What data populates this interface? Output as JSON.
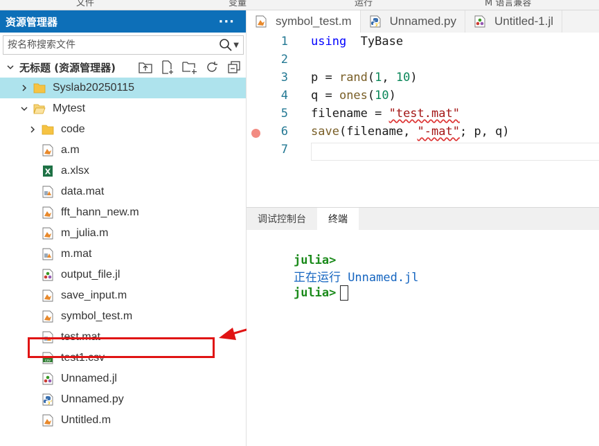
{
  "menu": [
    "文件",
    "变量",
    "运行",
    "M 语言兼容"
  ],
  "sidebar": {
    "title": "资源管理器",
    "more": "···",
    "search_placeholder": "按名称搜索文件",
    "root_label": "无标题 (资源管理器)",
    "items": [
      {
        "label": "Syslab20250115",
        "icon": "folder-icon",
        "depth": 1,
        "expanded": false,
        "selected": true
      },
      {
        "label": "Mytest",
        "icon": "folder-open-icon",
        "depth": 1,
        "expanded": true
      },
      {
        "label": "code",
        "icon": "folder-icon",
        "depth": 2,
        "expanded": false
      },
      {
        "label": "a.m",
        "icon": "m-file-icon",
        "depth": 2
      },
      {
        "label": "a.xlsx",
        "icon": "excel-icon",
        "depth": 2
      },
      {
        "label": "data.mat",
        "icon": "mat-file-icon",
        "depth": 2
      },
      {
        "label": "fft_hann_new.m",
        "icon": "m-file-icon",
        "depth": 2
      },
      {
        "label": "m_julia.m",
        "icon": "m-file-icon",
        "depth": 2
      },
      {
        "label": "m.mat",
        "icon": "mat-file-icon",
        "depth": 2
      },
      {
        "label": "output_file.jl",
        "icon": "julia-icon",
        "depth": 2
      },
      {
        "label": "save_input.m",
        "icon": "m-file-icon",
        "depth": 2
      },
      {
        "label": "symbol_test.m",
        "icon": "m-file-icon",
        "depth": 2
      },
      {
        "label": "test.mat",
        "icon": "mat-file-icon",
        "depth": 2
      },
      {
        "label": "test1.csv",
        "icon": "csv-icon",
        "depth": 2
      },
      {
        "label": "Unnamed.jl",
        "icon": "julia-icon",
        "depth": 2
      },
      {
        "label": "Unnamed.py",
        "icon": "python-icon",
        "depth": 2
      },
      {
        "label": "Untitled.m",
        "icon": "m-file-icon",
        "depth": 2
      }
    ]
  },
  "editor": {
    "tabs": [
      {
        "label": "symbol_test.m",
        "icon": "m-file-icon",
        "active": true
      },
      {
        "label": "Unnamed.py",
        "icon": "python-icon"
      },
      {
        "label": "Untitled-1.jl",
        "icon": "julia-icon"
      }
    ],
    "lines": [
      {
        "n": "1",
        "tokens": [
          [
            "kw",
            "using"
          ],
          [
            "",
            "  TyBase"
          ]
        ]
      },
      {
        "n": "2",
        "tokens": []
      },
      {
        "n": "3",
        "tokens": [
          [
            "",
            "p = "
          ],
          [
            "fn",
            "rand"
          ],
          [
            "",
            "("
          ],
          [
            "num",
            "1"
          ],
          [
            "",
            ", "
          ],
          [
            "num",
            "10"
          ],
          [
            "",
            ")"
          ]
        ]
      },
      {
        "n": "4",
        "tokens": [
          [
            "",
            "q = "
          ],
          [
            "fn",
            "ones"
          ],
          [
            "",
            "("
          ],
          [
            "num",
            "10"
          ],
          [
            "",
            ")"
          ]
        ]
      },
      {
        "n": "5",
        "tokens": [
          [
            "",
            "filename = "
          ],
          [
            "str",
            "\"test.mat\""
          ]
        ]
      },
      {
        "n": "6",
        "tokens": [
          [
            "fn",
            "save"
          ],
          [
            "",
            "(filename, "
          ],
          [
            "str",
            "\"-mat\""
          ],
          [
            "",
            "; p, q)"
          ]
        ],
        "breakpoint": true
      },
      {
        "n": "7",
        "tokens": [],
        "current": true
      }
    ]
  },
  "panel": {
    "tabs": [
      "调试控制台",
      "终端"
    ],
    "active_tab": 1,
    "terminal": [
      {
        "prompt": "julia>",
        "text": "正在运行 Unnamed.jl"
      },
      {
        "prompt": "julia>",
        "text": ""
      }
    ]
  },
  "colors": {
    "accent": "#0d6fb8",
    "selected": "#aee3ed",
    "annotation": "#e01414"
  }
}
